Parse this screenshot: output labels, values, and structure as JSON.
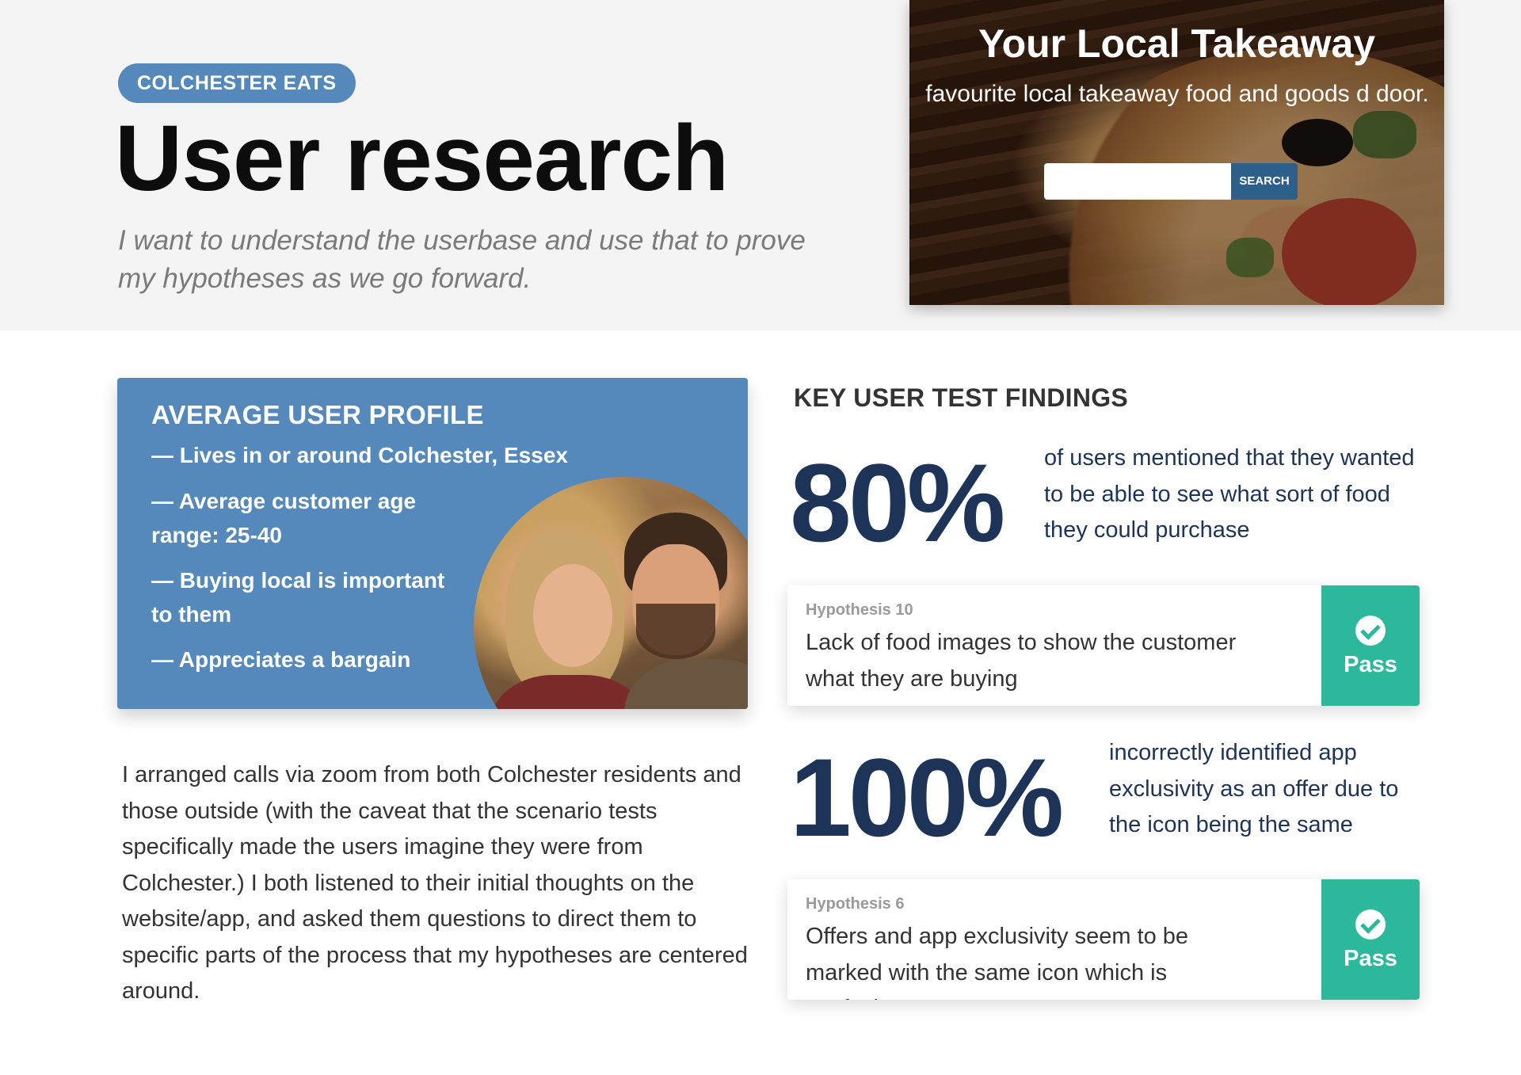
{
  "hero": {
    "tag": "COLCHESTER EATS",
    "title": "User research",
    "subtitle": "I want to understand the userbase and use that to prove my hypotheses as we go forward.",
    "screenshot": {
      "title": "Your Local Takeaway",
      "subtitle": "favourite local takeaway food and goods d door.",
      "search_button": "SEARCH"
    }
  },
  "profile": {
    "title": "AVERAGE USER PROFILE",
    "items": [
      "— Lives in or around Colchester, Essex",
      "—  Average customer age",
      "range: 25-40",
      "— Buying local is important",
      "to them",
      "— Appreciates a bargain"
    ]
  },
  "body_text": "I arranged calls via zoom from both Colchester residents and those outside (with the caveat that the scenario tests specifically made the users imagine they were from Colchester.) I both listened to their initial thoughts on the website/app, and asked them questions to direct them to specific parts of the process that my hypotheses are centered around.",
  "findings": {
    "title": "KEY USER TEST FINDINGS",
    "stats": [
      {
        "value": "80%",
        "text": "of users mentioned that they wanted to be able to see what sort of food they could purchase"
      },
      {
        "value": "100%",
        "text": "incorrectly identified app exclusivity as an offer due to the icon being the same"
      }
    ],
    "hypotheses": [
      {
        "label": "Hypothesis 10",
        "text": "Lack of food images to show the customer what they are buying",
        "status": "Pass"
      },
      {
        "label": "Hypothesis 6",
        "text": "Offers and app exclusivity seem to be marked with the same icon which is confusing",
        "status": "Pass"
      }
    ]
  },
  "colors": {
    "accent_blue": "#5589bb",
    "navy": "#1e3358",
    "pass_green": "#2cb89a"
  }
}
